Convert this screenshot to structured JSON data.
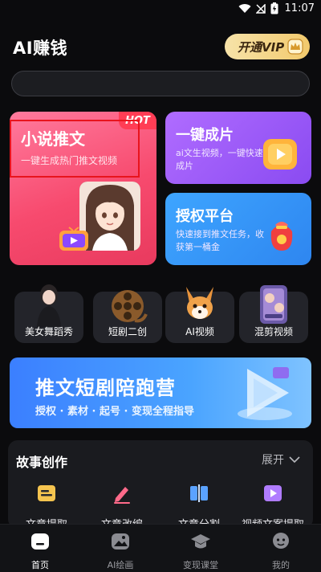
{
  "status": {
    "time": "11:07"
  },
  "header": {
    "title": "AI赚钱",
    "vip_label": "开通VIP"
  },
  "search": {
    "placeholder": ""
  },
  "cards": {
    "novel": {
      "title": "小说推文",
      "subtitle": "一键生成热门推文视频",
      "badge": "HOT"
    },
    "oneclick": {
      "title": "一键成片",
      "subtitle": "ai文生视频，一键快速成片"
    },
    "license": {
      "title": "授权平台",
      "subtitle": "快速接到推文任务，收获第一桶金"
    }
  },
  "categories": [
    {
      "label": "美女舞蹈秀"
    },
    {
      "label": "短剧二创"
    },
    {
      "label": "AI视频"
    },
    {
      "label": "混剪视频"
    }
  ],
  "banner": {
    "title": "推文短剧陪跑营",
    "subtitle": "授权 · 素材 · 起号 · 变现全程指导"
  },
  "story": {
    "title": "故事创作",
    "expand_label": "展开",
    "tools": [
      {
        "label": "文章提取"
      },
      {
        "label": "文章改编"
      },
      {
        "label": "文章分割"
      },
      {
        "label": "视频文案提取"
      }
    ]
  },
  "tabs": [
    {
      "label": "首页",
      "icon": "home-icon"
    },
    {
      "label": "AI绘画",
      "icon": "image-icon"
    },
    {
      "label": "变现课堂",
      "icon": "graduation-cap-icon"
    },
    {
      "label": "我的",
      "icon": "profile-icon"
    }
  ],
  "colors": {
    "background": "#0b0b0d",
    "vip_gold": "#f2c96c",
    "novel_card": "#f74a6e",
    "oneclick_card": "#8a4bf1",
    "license_card": "#2e86f0",
    "banner": "#3b7fff",
    "highlight": "#e8141d"
  }
}
